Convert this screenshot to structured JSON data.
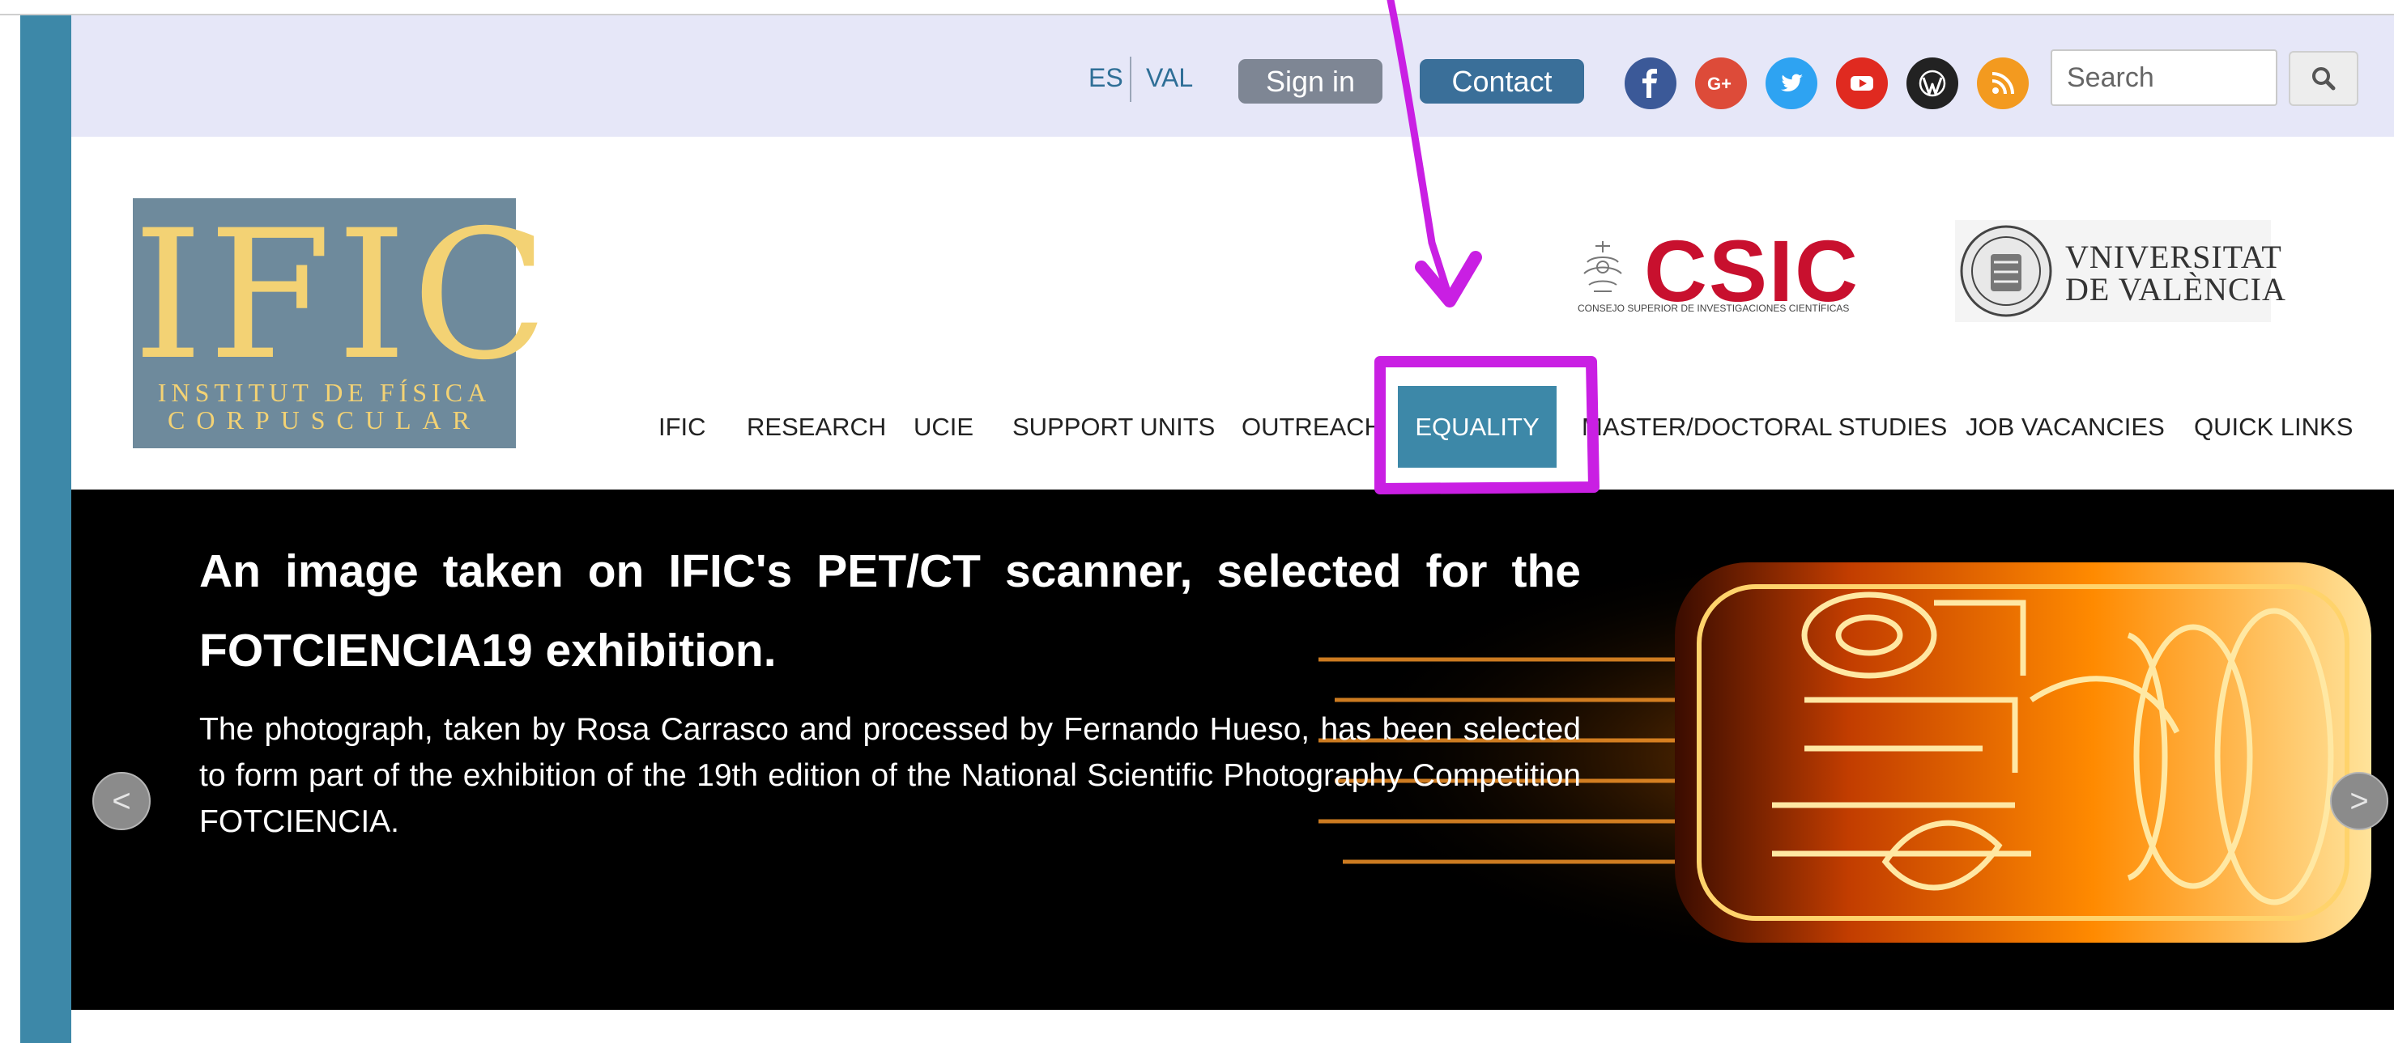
{
  "topbar": {
    "lang_es": "ES",
    "lang_val": "VAL",
    "signin_label": "Sign in",
    "contact_label": "Contact",
    "social_icons": [
      "facebook-icon",
      "google-plus-icon",
      "twitter-icon",
      "youtube-icon",
      "wordpress-icon",
      "rss-icon"
    ],
    "search_placeholder": "Search"
  },
  "header": {
    "logo_big": "IFIC",
    "logo_line1": "INSTITUT DE FÍSICA",
    "logo_line2": "CORPUSCULAR",
    "csic_word": "CSIC",
    "csic_sub": "CONSEJO SUPERIOR DE INVESTIGACIONES CIENTÍFICAS",
    "uv_line1": "VNIVERSITAT",
    "uv_line2": "DE VALÈNCIA"
  },
  "nav": {
    "items": [
      "IFIC",
      "RESEARCH",
      "UCIE",
      "SUPPORT UNITS",
      "OUTREACH",
      "EQUALITY",
      "MASTER/DOCTORAL STUDIES",
      "JOB VACANCIES",
      "QUICK LINKS"
    ],
    "active": "EQUALITY"
  },
  "hero": {
    "title": "An image taken on IFIC's PET/CT scanner, selected for the FOTCIENCIA19 exhibition.",
    "text": "The photograph, taken by Rosa Carrasco and processed by Fernando Hueso, has been selected to form part of the exhibition of the 19th edition of the National Scientific Photography Competition FOTCIENCIA.",
    "prev_label": "<",
    "next_label": ">"
  },
  "colors": {
    "accent": "#3d88a8",
    "topbar_bg": "#e6e7f8",
    "signin_bg": "#7e8694",
    "contact_bg": "#3a6f99",
    "annotation": "#c91fe3"
  }
}
